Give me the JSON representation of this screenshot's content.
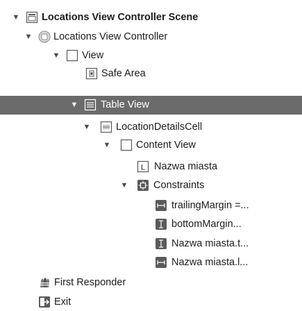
{
  "outline": {
    "rows": [
      {
        "id": "scene",
        "label": "Locations View Controller Scene",
        "expanded": true,
        "bold": true,
        "icon": "scene-icon"
      },
      {
        "id": "view-controller",
        "label": "Locations View Controller",
        "expanded": true,
        "icon": "view-controller-icon"
      },
      {
        "id": "view",
        "label": "View",
        "expanded": true,
        "icon": "view-icon"
      },
      {
        "id": "safe-area",
        "label": "Safe Area",
        "icon": "safe-area-icon"
      },
      {
        "id": "table-view",
        "label": "Table View",
        "expanded": true,
        "selected": true,
        "icon": "table-view-icon"
      },
      {
        "id": "location-details-cell",
        "label": "LocationDetailsCell",
        "expanded": true,
        "icon": "table-cell-icon"
      },
      {
        "id": "content-view",
        "label": "Content View",
        "expanded": true,
        "icon": "view-icon"
      },
      {
        "id": "nazwa-miasta-label",
        "label": "Nazwa miasta",
        "icon": "label-icon"
      },
      {
        "id": "constraints",
        "label": "Constraints",
        "expanded": true,
        "icon": "constraints-icon"
      },
      {
        "id": "constraint-trailing",
        "label": "trailingMargin =...",
        "icon": "constraint-horizontal-icon"
      },
      {
        "id": "constraint-bottom",
        "label": "bottomMargin...",
        "icon": "constraint-vertical-icon"
      },
      {
        "id": "constraint-nazwa-t",
        "label": "Nazwa miasta.t...",
        "icon": "constraint-vertical-icon"
      },
      {
        "id": "constraint-nazwa-l",
        "label": "Nazwa miasta.l...",
        "icon": "constraint-horizontal-icon"
      },
      {
        "id": "first-responder",
        "label": "First Responder",
        "icon": "first-responder-icon"
      },
      {
        "id": "exit",
        "label": "Exit",
        "icon": "exit-icon"
      }
    ]
  },
  "colors": {
    "selection": "#6b6b6b",
    "text": "#1c1c1c",
    "selected_text": "#ffffff",
    "icon_gray": "#5a5a5a"
  }
}
